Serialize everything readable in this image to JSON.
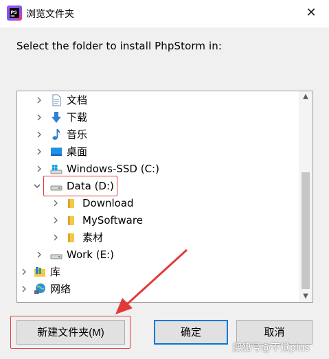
{
  "window": {
    "title": "浏览文件夹",
    "close_glyph": "✕"
  },
  "prompt": "Select the folder to install PhpStorm in:",
  "tree": {
    "items": [
      {
        "label": "文档",
        "icon": "document-icon",
        "expanded": false
      },
      {
        "label": "下载",
        "icon": "download-icon",
        "expanded": false
      },
      {
        "label": "音乐",
        "icon": "music-icon",
        "expanded": false
      },
      {
        "label": "桌面",
        "icon": "desktop-icon",
        "expanded": false
      },
      {
        "label": "Windows-SSD (C:)",
        "icon": "windows-drive-icon",
        "expanded": false
      },
      {
        "label": "Data (D:)",
        "icon": "drive-icon",
        "expanded": true,
        "selected": true
      },
      {
        "label": "Download",
        "icon": "folder-icon",
        "expanded": false
      },
      {
        "label": "MySoftware",
        "icon": "folder-icon",
        "expanded": false
      },
      {
        "label": "素材",
        "icon": "folder-icon",
        "expanded": false
      },
      {
        "label": "Work (E:)",
        "icon": "drive-icon",
        "expanded": false
      },
      {
        "label": "库",
        "icon": "library-icon",
        "expanded": false
      },
      {
        "label": "网络",
        "icon": "network-icon",
        "expanded": false
      }
    ]
  },
  "buttons": {
    "new_folder": "新建文件夹(M)",
    "ok": "确定",
    "cancel": "取消"
  },
  "watermark": "搜狐号@不觉plus",
  "colors": {
    "highlight": "#e23a3a",
    "accent": "#0078d7",
    "folder": "#f2c84b"
  }
}
